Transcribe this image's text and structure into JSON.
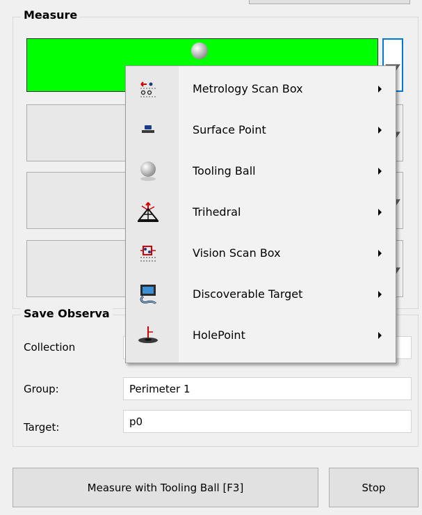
{
  "measure": {
    "title": "Measure",
    "slot_active_color": "#00ff00",
    "slot_icons": [
      "tooling-ball-icon",
      "",
      "",
      ""
    ]
  },
  "menu": {
    "items": [
      {
        "label": "Metrology Scan Box",
        "icon": "metrology-scan-box-icon"
      },
      {
        "label": "Surface Point",
        "icon": "surface-point-icon"
      },
      {
        "label": "Tooling Ball",
        "icon": "tooling-ball-icon"
      },
      {
        "label": "Trihedral",
        "icon": "trihedral-icon"
      },
      {
        "label": "Vision Scan Box",
        "icon": "vision-scan-box-icon"
      },
      {
        "label": "Discoverable Target",
        "icon": "discoverable-target-icon"
      },
      {
        "label": "HolePoint",
        "icon": "holepoint-icon"
      }
    ]
  },
  "save_observations": {
    "title": "Save Observa",
    "collection_label": "Collection",
    "collection_value": "",
    "group_label": "Group:",
    "group_value": "Perimeter 1",
    "target_label": "Target:",
    "target_value": "p0"
  },
  "buttons": {
    "measure_label": "Measure with Tooling Ball [F3]",
    "stop_label": "Stop"
  },
  "colors": {
    "accent": "#0078d7",
    "active_slot": "#00ff00"
  }
}
